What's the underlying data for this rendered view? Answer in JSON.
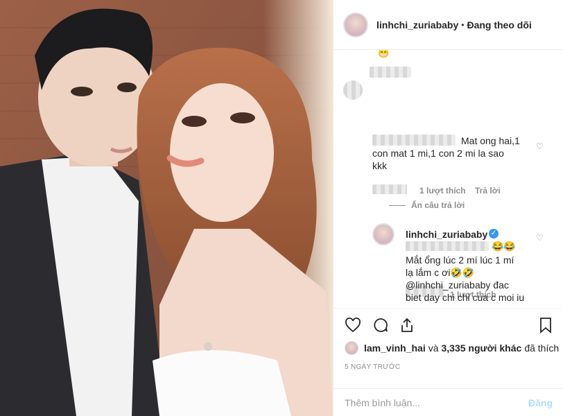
{
  "post": {
    "username": "linhchi_zuriababy",
    "separator": "•",
    "follow_label": "Đang theo dõi"
  },
  "comments": {
    "top_emoji": "😁",
    "c1": {
      "text_line1": "Mat ong hai,1",
      "text_line2": "con mat 1 mi,1 con 2 mi la sao",
      "text_line3": "kkk",
      "likes": "1 lượt thích",
      "reply_label": "Trả lời",
      "hide_replies": "Ẩn câu trả lời"
    },
    "r1": {
      "username": "linhchi_zuriababy",
      "verified": "✓",
      "emoji": "😂😂",
      "text_line1": "Mắt ổng lúc 2 mí lúc 1 mí",
      "text_line2": "lạ lắm c ơi🤣🤣",
      "likes": "1 lượt thích"
    },
    "r2": {
      "text_line1": "@linhchi_zuriababy đac",
      "text_line2": "biet day chi chi cua c moi iu"
    }
  },
  "likes": {
    "user": "lam_vinh_hai",
    "middle": "và",
    "others": "3,335 người khác",
    "suffix": "đã thích"
  },
  "timestamp": "5 NGÀY TRƯỚC",
  "add_comment": {
    "placeholder": "Thêm bình luận...",
    "post_label": "Đăng"
  },
  "colors": {
    "text": "#262626",
    "muted": "#8e8e8e",
    "verified": "#3897f0",
    "post_disabled": "#b2dffc"
  }
}
